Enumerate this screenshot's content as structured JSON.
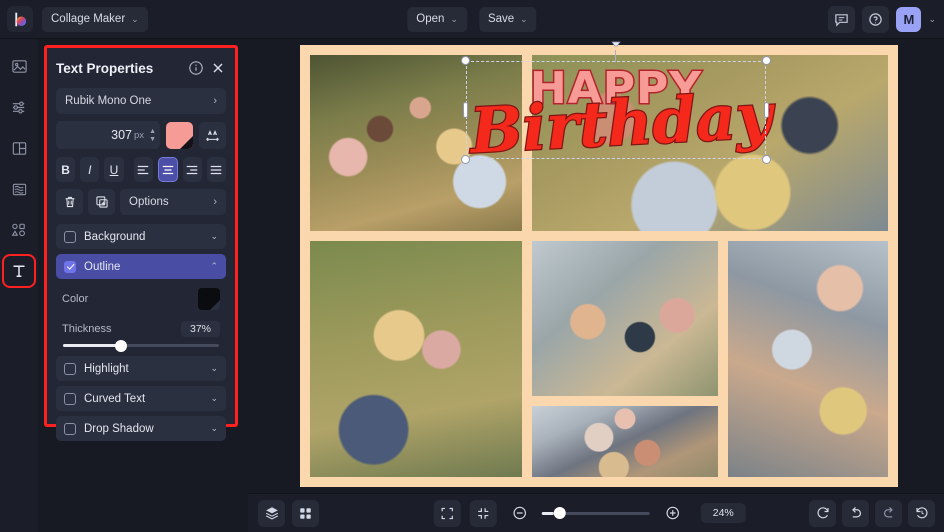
{
  "app": {
    "brand_icon": "colorwheel-logo-icon",
    "workspace": "Collage Maker",
    "accent_purple": "#6f74e8",
    "selection_red": "#ff2020"
  },
  "topbar": {
    "open_label": "Open",
    "save_label": "Save",
    "feedback_icon": "comment-icon",
    "help_icon": "help-circle-icon",
    "avatar_initial": "M",
    "caret": "⌄"
  },
  "rail": {
    "items": [
      {
        "name": "image-icon",
        "label": "Images",
        "selected": false
      },
      {
        "name": "adjustments-icon",
        "label": "Adjust",
        "selected": false
      },
      {
        "name": "layout-icon",
        "label": "Layouts",
        "selected": false
      },
      {
        "name": "layers-icon",
        "label": "Backgrounds",
        "selected": false
      },
      {
        "name": "shapes-icon",
        "label": "Graphics",
        "selected": false
      },
      {
        "name": "text-icon",
        "label": "Text",
        "selected": true
      }
    ]
  },
  "panel": {
    "title": "Text Properties",
    "info_icon": "info-circle-icon",
    "close_icon": "close-icon",
    "font_family": "Rubik Mono One",
    "font_arrow": "›",
    "font_size": "307",
    "font_size_unit": "px",
    "color_swatch": "#f79b97",
    "spacing_icon": "letter-spacing-icon",
    "format": {
      "bold": "B",
      "italic": "I",
      "underline": "U",
      "align_left": "align-left-icon",
      "align_center": "align-center-icon",
      "align_right": "align-right-icon",
      "align_justify": "align-justify-icon",
      "active_align": "center"
    },
    "delete_icon": "trash-icon",
    "duplicate_icon": "duplicate-icon",
    "options_label": "Options",
    "options_arrow": "›",
    "sections": [
      {
        "label": "Background",
        "checked": false,
        "expanded": false,
        "chevron": "⌄"
      },
      {
        "label": "Outline",
        "checked": true,
        "expanded": true,
        "chevron": "⌃"
      },
      {
        "label": "Highlight",
        "checked": false,
        "expanded": false,
        "chevron": "⌄"
      },
      {
        "label": "Curved Text",
        "checked": false,
        "expanded": false,
        "chevron": "⌄"
      },
      {
        "label": "Drop Shadow",
        "checked": false,
        "expanded": false,
        "chevron": "⌄"
      }
    ],
    "outline": {
      "color_label": "Color",
      "color_value": "#0b0c10",
      "thickness_label": "Thickness",
      "thickness_value": "37%",
      "thickness_pct": 37
    }
  },
  "canvas": {
    "text_line1": "HAPPY",
    "text_line2": "Birthday",
    "text_line1_color": "#f79b97",
    "text_line2_color": "#f4291c",
    "outline_color": "#7e1414",
    "collage_border_color": "#fbd7ae",
    "photos": [
      {
        "name": "photo-group-picnic-top-left"
      },
      {
        "name": "photo-reclining-top-right"
      },
      {
        "name": "photo-two-friends-sunglasses-left"
      },
      {
        "name": "photo-back-to-back-center"
      },
      {
        "name": "photo-three-sunglasses-bottom"
      },
      {
        "name": "photo-circle-heads-right"
      }
    ]
  },
  "bottombar": {
    "layers_icon": "layers-stack-icon",
    "grid_icon": "grid-view-icon",
    "fullscreen_icon": "expand-icon",
    "fit_icon": "collapse-icon",
    "zoom_out_icon": "zoom-out-icon",
    "zoom_in_icon": "zoom-in-icon",
    "zoom_value": "24%",
    "reset_icon": "reset-icon",
    "undo_icon": "undo-icon",
    "redo_icon": "redo-icon",
    "history_icon": "history-icon"
  }
}
